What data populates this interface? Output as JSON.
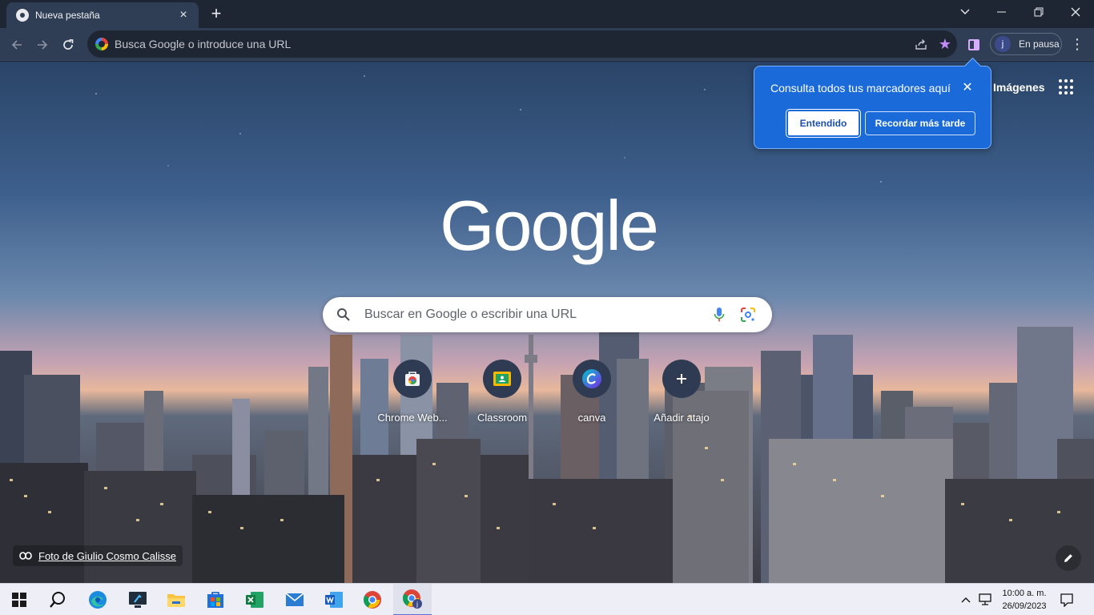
{
  "browser": {
    "tab": {
      "title": "Nueva pestaña",
      "close": "×"
    },
    "new_tab": "+",
    "window_controls": {
      "dropdown": "⌄",
      "minimize": "—",
      "restore": "❐",
      "close": "✕"
    }
  },
  "toolbar": {
    "omnibox_placeholder": "Busca Google o introduce una URL",
    "profile_initial": "j",
    "profile_label": "En pausa"
  },
  "page": {
    "top_link_images": "Imágenes",
    "logo_text": "Google",
    "search_placeholder": "Buscar en Google o escribir una URL",
    "shortcuts": [
      {
        "label": "Chrome Web...",
        "icon": "chrome-web-store-icon"
      },
      {
        "label": "Classroom",
        "icon": "classroom-icon"
      },
      {
        "label": "canva",
        "icon": "canva-icon"
      },
      {
        "label": "Añadir atajo",
        "icon": "plus-icon"
      }
    ],
    "attribution": "Foto de Giulio Cosmo Calisse"
  },
  "callout": {
    "text": "Consulta todos tus marcadores aquí",
    "primary_button": "Entendido",
    "secondary_button": "Recordar más tarde",
    "close": "✕"
  },
  "taskbar": {
    "apps": [
      "windows-start-icon",
      "search-icon",
      "edge-icon",
      "app-icon",
      "file-explorer-icon",
      "store-icon",
      "excel-icon",
      "mail-icon",
      "word-icon",
      "chrome-icon",
      "chrome-profile-icon"
    ],
    "time": "10:00 a. m.",
    "date": "26/09/2023"
  },
  "colors": {
    "tab_strip": "#1f2633",
    "toolbar": "#2f3d55",
    "callout_bg": "#1a6ad9",
    "accent_purple": "#c58af9",
    "taskbar": "#eeeff6"
  }
}
